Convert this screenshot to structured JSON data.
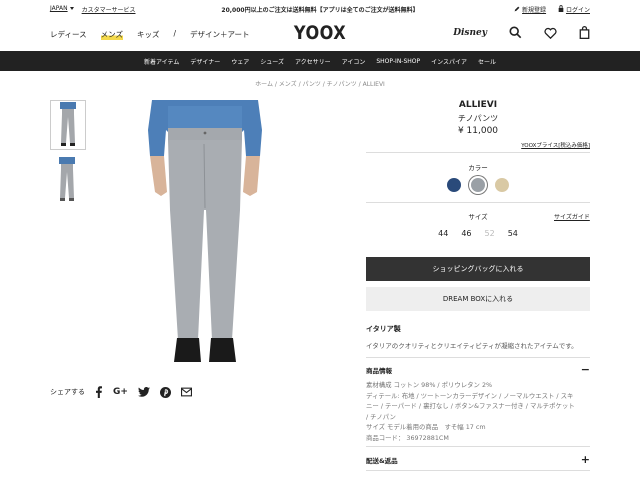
{
  "topbar": {
    "region": "JAPAN",
    "customer_service": "カスタマーサービス",
    "promo": "20,000円以上のご注文は送料無料【アプリは全てのご注文が送料無料】",
    "register": "新規登録",
    "login": "ログイン"
  },
  "header": {
    "categories": [
      "レディース",
      "メンズ",
      "キッズ",
      "/",
      "デザイン＋アート"
    ],
    "logo": "YOOX",
    "disney_label": "Disney"
  },
  "nav": {
    "items": [
      "新着アイテム",
      "デザイナー",
      "ウェア",
      "シューズ",
      "アクセサリー",
      "アイコン",
      "SHOP-IN-SHOP",
      "インスパイア",
      "セール"
    ]
  },
  "breadcrumb": "ホーム / メンズ / パンツ / チノパンツ / ALLIEVI",
  "share": {
    "label": "シェアする"
  },
  "product": {
    "brand": "ALLIEVI",
    "type": "チノパンツ",
    "price": "¥ 11,000",
    "yoox_price_link": "YOOXプライス[税込み価格]",
    "color_label": "カラー",
    "colors": [
      "#2a4a7a",
      "#9aa0a6",
      "#d9c9a4"
    ],
    "size_label": "サイズ",
    "size_guide": "サイズガイド",
    "sizes": [
      "44",
      "46",
      "52",
      "54"
    ],
    "bag_button": "ショッピングバッグに入れる",
    "dream_button": "DREAM BOXに入れる",
    "made_in": "イタリア製",
    "made_in_desc": "イタリアのクオリティとクリエイティビティが凝縮されたアイテムです。",
    "info_header": "商品情報",
    "info_lines": [
      "素材構成 コットン 98% / ポリウレタン 2%",
      "ディテール: 布地 / ツートーンカラーデザイン / ノーマルウエスト / スキ",
      "ニー / テーパード / 裏打なし / ボタン&ファスナー付き / マルチポケット",
      " / チノパン",
      "サイズ モデル着用の商品　すそ幅 17 cm",
      "商品コード： 36972881CM"
    ],
    "shipping_header": "配送&返品"
  }
}
